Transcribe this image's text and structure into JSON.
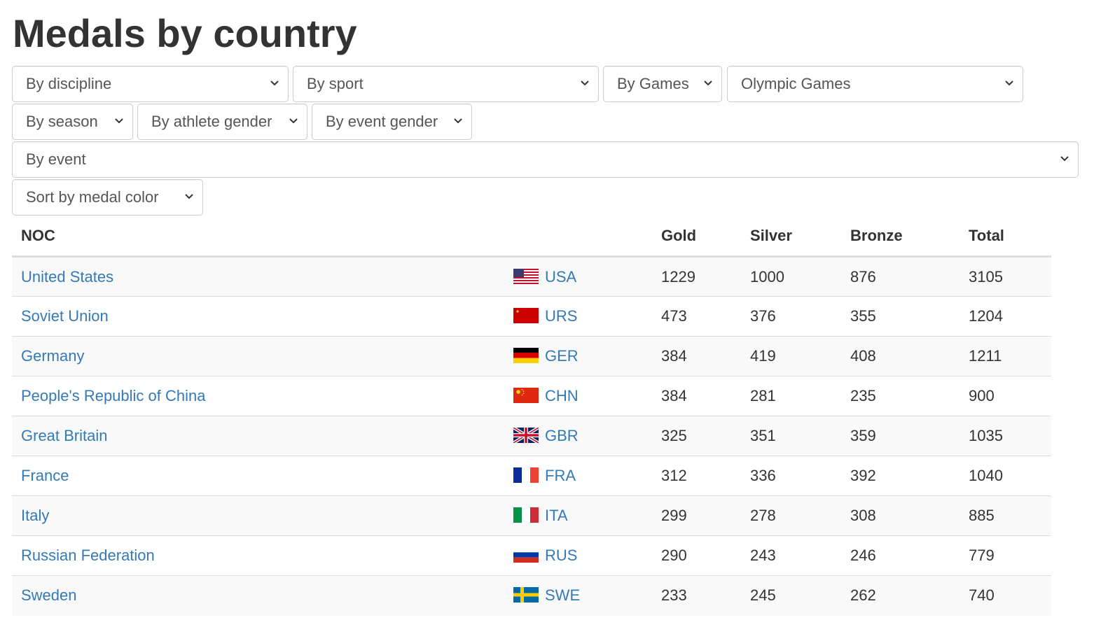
{
  "page": {
    "title": "Medals by country"
  },
  "filters": [
    {
      "key": "discipline",
      "label": "By discipline"
    },
    {
      "key": "sport",
      "label": "By sport"
    },
    {
      "key": "games",
      "label": "By Games"
    },
    {
      "key": "olympic_games",
      "label": "Olympic Games"
    },
    {
      "key": "season",
      "label": "By season"
    },
    {
      "key": "athlete_gender",
      "label": "By athlete gender"
    },
    {
      "key": "event_gender",
      "label": "By event gender"
    },
    {
      "key": "event",
      "label": "By event"
    },
    {
      "key": "sort",
      "label": "Sort by medal color"
    }
  ],
  "table": {
    "headers": {
      "noc": "NOC",
      "code": "",
      "gold": "Gold",
      "silver": "Silver",
      "bronze": "Bronze",
      "total": "Total"
    },
    "rows": [
      {
        "country": "United States",
        "code": "USA",
        "flag": "usa-flag-icon",
        "gold": "1229",
        "silver": "1000",
        "bronze": "876",
        "total": "3105"
      },
      {
        "country": "Soviet Union",
        "code": "URS",
        "flag": "urs-flag-icon",
        "gold": "473",
        "silver": "376",
        "bronze": "355",
        "total": "1204"
      },
      {
        "country": "Germany",
        "code": "GER",
        "flag": "ger-flag-icon",
        "gold": "384",
        "silver": "419",
        "bronze": "408",
        "total": "1211"
      },
      {
        "country": "People's Republic of China",
        "code": "CHN",
        "flag": "chn-flag-icon",
        "gold": "384",
        "silver": "281",
        "bronze": "235",
        "total": "900"
      },
      {
        "country": "Great Britain",
        "code": "GBR",
        "flag": "gbr-flag-icon",
        "gold": "325",
        "silver": "351",
        "bronze": "359",
        "total": "1035"
      },
      {
        "country": "France",
        "code": "FRA",
        "flag": "fra-flag-icon",
        "gold": "312",
        "silver": "336",
        "bronze": "392",
        "total": "1040"
      },
      {
        "country": "Italy",
        "code": "ITA",
        "flag": "ita-flag-icon",
        "gold": "299",
        "silver": "278",
        "bronze": "308",
        "total": "885"
      },
      {
        "country": "Russian Federation",
        "code": "RUS",
        "flag": "rus-flag-icon",
        "gold": "290",
        "silver": "243",
        "bronze": "246",
        "total": "779"
      },
      {
        "country": "Sweden",
        "code": "SWE",
        "flag": "swe-flag-icon",
        "gold": "233",
        "silver": "245",
        "bronze": "262",
        "total": "740"
      }
    ]
  },
  "colors": {
    "link": "#337ab7",
    "text": "#333333",
    "border": "#dddddd",
    "stripe": "#f9f9f9"
  }
}
